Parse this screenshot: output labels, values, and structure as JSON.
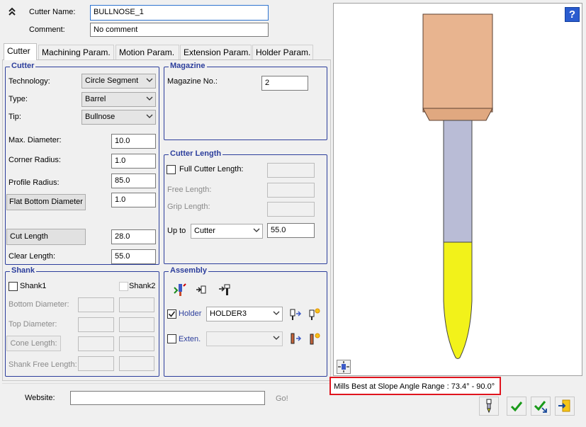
{
  "header": {
    "cutter_name_label": "Cutter Name:",
    "cutter_name_value": "BULLNOSE_1",
    "comment_label": "Comment:",
    "comment_value": "No comment"
  },
  "tabs": [
    {
      "label": "Cutter"
    },
    {
      "label": "Machining Param."
    },
    {
      "label": "Motion Param."
    },
    {
      "label": "Extension Param."
    },
    {
      "label": "Holder Param."
    }
  ],
  "cutter_group": {
    "title": "Cutter",
    "technology_label": "Technology:",
    "technology_value": "Circle Segment",
    "type_label": "Type:",
    "type_value": "Barrel",
    "tip_label": "Tip:",
    "tip_value": "Bullnose",
    "max_diameter_label": "Max. Diameter:",
    "max_diameter_value": "10.0",
    "corner_radius_label": "Corner Radius:",
    "corner_radius_value": "1.0",
    "profile_radius_label": "Profile Radius:",
    "profile_radius_value": "85.0",
    "flat_bottom_label": "Flat Bottom Diameter",
    "flat_bottom_value": "1.0",
    "cut_length_label": "Cut Length",
    "cut_length_value": "28.0",
    "clear_length_label": "Clear Length:",
    "clear_length_value": "55.0"
  },
  "magazine_group": {
    "title": "Magazine",
    "magazine_no_label": "Magazine No.:",
    "magazine_no_value": "2"
  },
  "cutter_length_group": {
    "title": "Cutter Length",
    "full_length_label": "Full Cutter Length:",
    "free_length_label": "Free Length:",
    "grip_length_label": "Grip Length:",
    "up_to_label": "Up to",
    "up_to_value": "Cutter",
    "up_to_length": "55.0"
  },
  "shank_group": {
    "title": "Shank",
    "shank1_label": "Shank1",
    "shank2_label": "Shank2",
    "bottom_diameter_label": "Bottom Diameter:",
    "top_diameter_label": "Top Diameter:",
    "cone_length_label": "Cone Length:",
    "shank_free_length_label": "Shank Free Length:"
  },
  "assembly_group": {
    "title": "Assembly",
    "holder_label": "Holder",
    "holder_value": "HOLDER3",
    "exten_label": "Exten.",
    "exten_value": ""
  },
  "footer": {
    "website_label": "Website:",
    "website_value": "",
    "go_label": "Go!"
  },
  "preview": {
    "slope_range_text": "Mills Best at Slope Angle Range : 73.4° - 90.0°"
  },
  "colors": {
    "group_border": "#2c3e9c",
    "holder_color": "#e8b48f",
    "shank_color": "#b9bcd6",
    "cutter_color": "#f2f21a",
    "highlight_border": "#e0141e"
  }
}
